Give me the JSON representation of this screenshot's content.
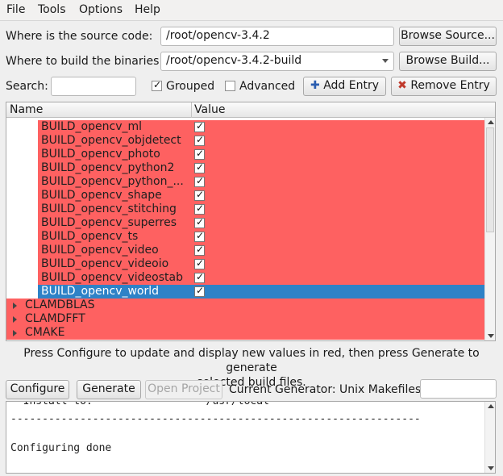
{
  "menu": {
    "file": "File",
    "tools": "Tools",
    "options": "Options",
    "help": "Help"
  },
  "source": {
    "label": "Where is the source code:",
    "value": "/root/opencv-3.4.2",
    "browse": "Browse Source..."
  },
  "build": {
    "label": "Where to build the binaries:",
    "value": "/root/opencv-3.4.2-build",
    "browse": "Browse Build..."
  },
  "search": {
    "label": "Search:",
    "value": ""
  },
  "grouped": {
    "label": "Grouped",
    "checked": true
  },
  "advanced": {
    "label": "Advanced",
    "checked": false
  },
  "add_entry": "Add Entry",
  "remove_entry": "Remove Entry",
  "tree": {
    "col_name": "Name",
    "col_value": "Value",
    "rows": [
      {
        "name": "BUILD_opencv_ml",
        "checked": true
      },
      {
        "name": "BUILD_opencv_objdetect",
        "checked": true
      },
      {
        "name": "BUILD_opencv_photo",
        "checked": true
      },
      {
        "name": "BUILD_opencv_python2",
        "checked": true
      },
      {
        "name": "BUILD_opencv_python_...",
        "checked": true
      },
      {
        "name": "BUILD_opencv_shape",
        "checked": true
      },
      {
        "name": "BUILD_opencv_stitching",
        "checked": true
      },
      {
        "name": "BUILD_opencv_superres",
        "checked": true
      },
      {
        "name": "BUILD_opencv_ts",
        "checked": true
      },
      {
        "name": "BUILD_opencv_video",
        "checked": true
      },
      {
        "name": "BUILD_opencv_videoio",
        "checked": true
      },
      {
        "name": "BUILD_opencv_videostab",
        "checked": true
      },
      {
        "name": "BUILD_opencv_world",
        "checked": true,
        "selected": true
      }
    ],
    "groups": [
      "CLAMDBLAS",
      "CLAMDFFT",
      "CMAKE"
    ]
  },
  "info": {
    "line1": "Press Configure to update and display new values in red, then press Generate to generate",
    "line2": "selected build files."
  },
  "configure": "Configure",
  "generate": "Generate",
  "open_project": "Open Project",
  "generator": "Current Generator: Unix Makefiles",
  "output": {
    "line0": "  Install to:                  /usr/local",
    "line1": "-----------------------------------------------------------------",
    "line2": "",
    "line3": "Configuring done"
  },
  "colors": {
    "new_value_red": "#fe6161",
    "selection_blue": "#2e82c7"
  }
}
